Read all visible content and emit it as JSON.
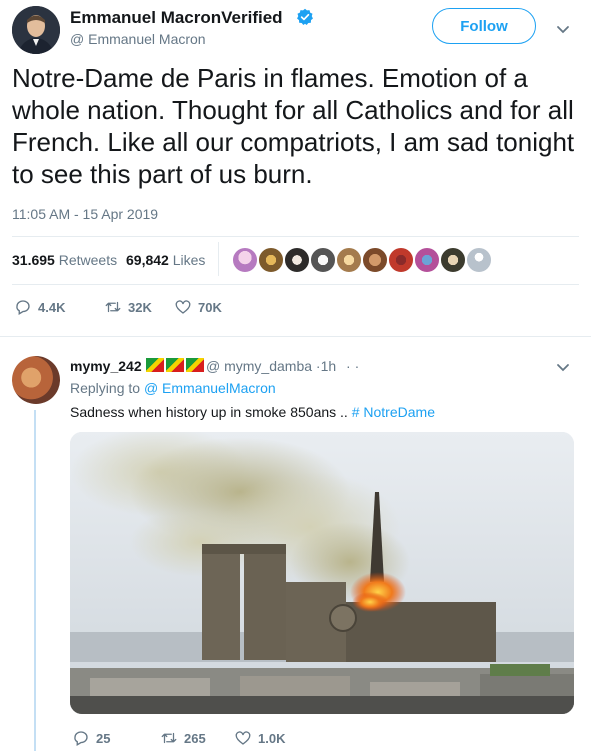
{
  "main_tweet": {
    "author_name": "Emmanuel MacronVerified",
    "author_handle": "@ Emmanuel Macron",
    "follow_label": "Follow",
    "text": "Notre-Dame de Paris in flames. Emotion of a whole nation. Thought for all Catholics and for all French. Like all our compatriots, I am sad tonight to see this part of us burn.",
    "timestamp": "11:05 AM - 15 Apr 2019",
    "retweets_count": "31.695",
    "retweets_label": "Retweets",
    "likes_count": "69,842",
    "likes_label": "Likes",
    "actions": {
      "replies": "4.4K",
      "retweets": "32K",
      "likes": "70K"
    }
  },
  "reply_tweet": {
    "author_name": "mymy_242",
    "author_handle": "@ mymy_damba",
    "time_ago": "·1h",
    "more": "· ·",
    "replying_to_prefix": "Replying to",
    "replying_to_handle": "@ EmmanuelMacron",
    "text": "Sadness when history up in smoke 850ans ..",
    "hashtag": "# NotreDame",
    "actions": {
      "replies": "25",
      "retweets": "265",
      "likes": "1.0K"
    }
  },
  "colors": {
    "accent": "#1da1f2",
    "text": "#14171a",
    "muted": "#657786",
    "divider": "#e6ecf0",
    "thread_line": "#c4dff4"
  },
  "icons": [
    "verified-badge-icon",
    "chevron-down-icon",
    "reply-icon",
    "retweet-icon",
    "like-icon"
  ]
}
